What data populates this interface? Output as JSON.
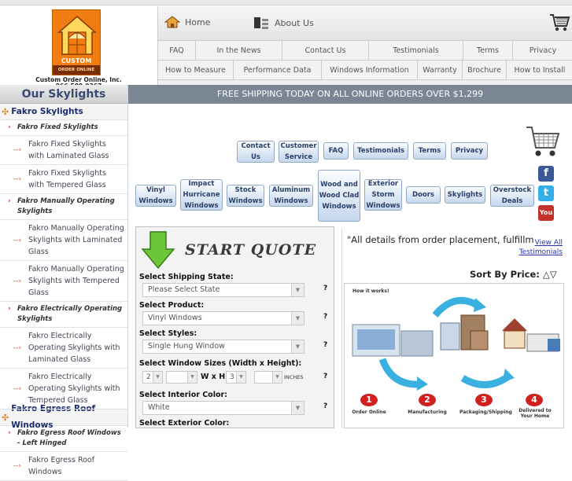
{
  "logo": {
    "badge_top": "CUSTOM",
    "badge_bottom": "ORDER ONLINE",
    "company": "Custom Order Online, Inc.",
    "phone": "866-589-9367"
  },
  "nav": {
    "home": "Home",
    "about": "About Us",
    "row1": [
      "FAQ",
      "In the News",
      "Contact Us",
      "Testimonials",
      "Terms",
      "Privacy"
    ],
    "row2": [
      "How to Measure",
      "Performance Data",
      "Windows Information",
      "Warranty",
      "Brochure",
      "How to Install"
    ]
  },
  "banner": "FREE SHIPPING TODAY ON ALL ONLINE ORDERS OVER $1,299",
  "sidebar": {
    "title": "Our Skylights",
    "cat1": "Fakro Skylights",
    "sub1": "Fakro Fixed Skylights",
    "leaf1": "Fakro Fixed Skylights with Laminated Glass",
    "leaf2": "Fakro Fixed Skylights with Tempered Glass",
    "sub2": "Fakro Manually Operating Skylights",
    "leaf3": "Fakro Manually Operating Skylights with Laminated Glass",
    "leaf4": "Fakro Manually Operating Skylights with Tempered Glass",
    "sub3": "Fakro Electrically Operating Skylights",
    "leaf5": "Fakro Electrically Operating Skylights with Laminated Glass",
    "leaf6": "Fakro Electrically Operating Skylights with Tempered Glass",
    "cat2": "Fakro Egress Roof Windows",
    "sub4": "Fakro Egress Roof Windows - Left Hinged",
    "leaf7": "Fakro Egress Roof Windows"
  },
  "buttons_top": {
    "contact": "Contact Us",
    "service": "Customer Service",
    "faq": "FAQ",
    "testimonials": "Testimonials",
    "terms": "Terms",
    "privacy": "Privacy"
  },
  "products": {
    "vinyl": "Vinyl Windows",
    "impact": "Impact Hurricane Windows",
    "stock": "Stock Windows",
    "aluminum": "Aluminum Windows",
    "wood": "Wood and Wood Clad Windows",
    "storm": "Exterior Storm Windows",
    "doors": "Doors",
    "skylights": "Skylights",
    "overstock": "Overstock Deals"
  },
  "quote": {
    "title": "START QUOTE",
    "state_label": "Select Shipping State:",
    "state_value": "Please Select State",
    "product_label": "Select Product:",
    "product_value": "Vinyl Windows",
    "style_label": "Select Styles:",
    "style_value": "Single Hung Window",
    "size_label": "Select Window Sizes (Width x Height):",
    "width_value": "2",
    "wxh": "W x H",
    "height_value": "3",
    "inches": "INCHES",
    "interior_label": "Select Interior Color:",
    "interior_value": "White",
    "exterior_label": "Select Exterior Color:",
    "help": "?"
  },
  "testimonial": {
    "text": "\"All details from order placement, fulfillm",
    "link": "View All Testimonials",
    "sort": "Sort By Price:"
  },
  "howitworks": {
    "title": "How it works!",
    "steps": [
      {
        "num": "1",
        "label": "Order Online"
      },
      {
        "num": "2",
        "label": "Manufacturing"
      },
      {
        "num": "3",
        "label": "Packaging/Shipping"
      },
      {
        "num": "4",
        "label": "Delivered to Your Home"
      }
    ]
  },
  "social": {
    "fb": "f",
    "tw": "t",
    "yt": "You"
  }
}
